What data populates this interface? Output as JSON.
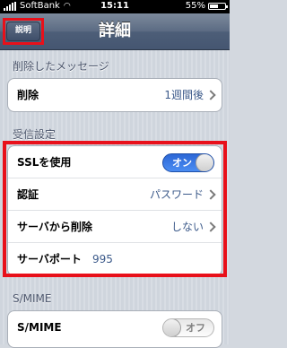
{
  "status_bar": {
    "carrier": "SoftBank",
    "time": "15:11",
    "battery_percent": "55%",
    "battery_level": 0.55
  },
  "nav": {
    "title": "詳細",
    "back_label": "説明"
  },
  "sections": {
    "deleted": {
      "header": "削除したメッセージ",
      "row": {
        "label": "削除",
        "value": "1週間後"
      }
    },
    "incoming": {
      "header": "受信設定",
      "ssl": {
        "label": "SSLを使用",
        "state": "オン"
      },
      "auth": {
        "label": "認証",
        "value": "パスワード"
      },
      "delete_server": {
        "label": "サーバから削除",
        "value": "しない"
      },
      "port": {
        "label": "サーバポート",
        "value": "995"
      }
    },
    "smime": {
      "header": "S/MIME",
      "row": {
        "label": "S/MIME",
        "state": "オフ"
      }
    }
  },
  "colors": {
    "highlight": "#e8101a",
    "toggle_on": "#2c67d6",
    "value_text": "#3c5a8a"
  }
}
